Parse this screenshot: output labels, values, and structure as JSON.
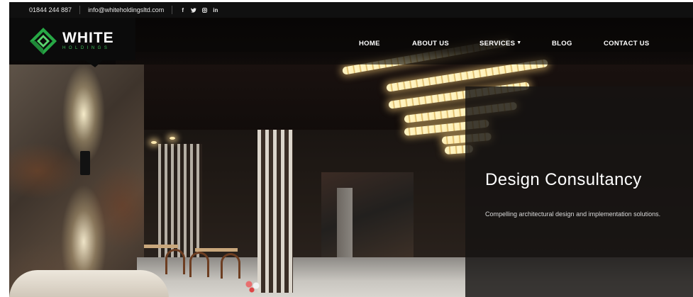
{
  "topbar": {
    "phone": "01844 244 887",
    "email": "info@whiteholdingsltd.com",
    "social": [
      {
        "icon": "facebook-icon",
        "glyph": "f"
      },
      {
        "icon": "twitter-icon",
        "glyph": "♦"
      },
      {
        "icon": "instagram-icon",
        "glyph": "▣"
      },
      {
        "icon": "linkedin-icon",
        "glyph": "in"
      }
    ]
  },
  "header": {
    "logo_main": "WHITE",
    "logo_sub": "HOLDINGS",
    "brand_color": "#3fbf5a"
  },
  "nav": {
    "home": "HOME",
    "about": "ABOUT US",
    "services": "SERVICES",
    "blog": "BLOG",
    "contact": "CONTACT US"
  },
  "hero": {
    "title": "Design Consultancy",
    "description": "Compelling architectural design and implementation solutions."
  }
}
